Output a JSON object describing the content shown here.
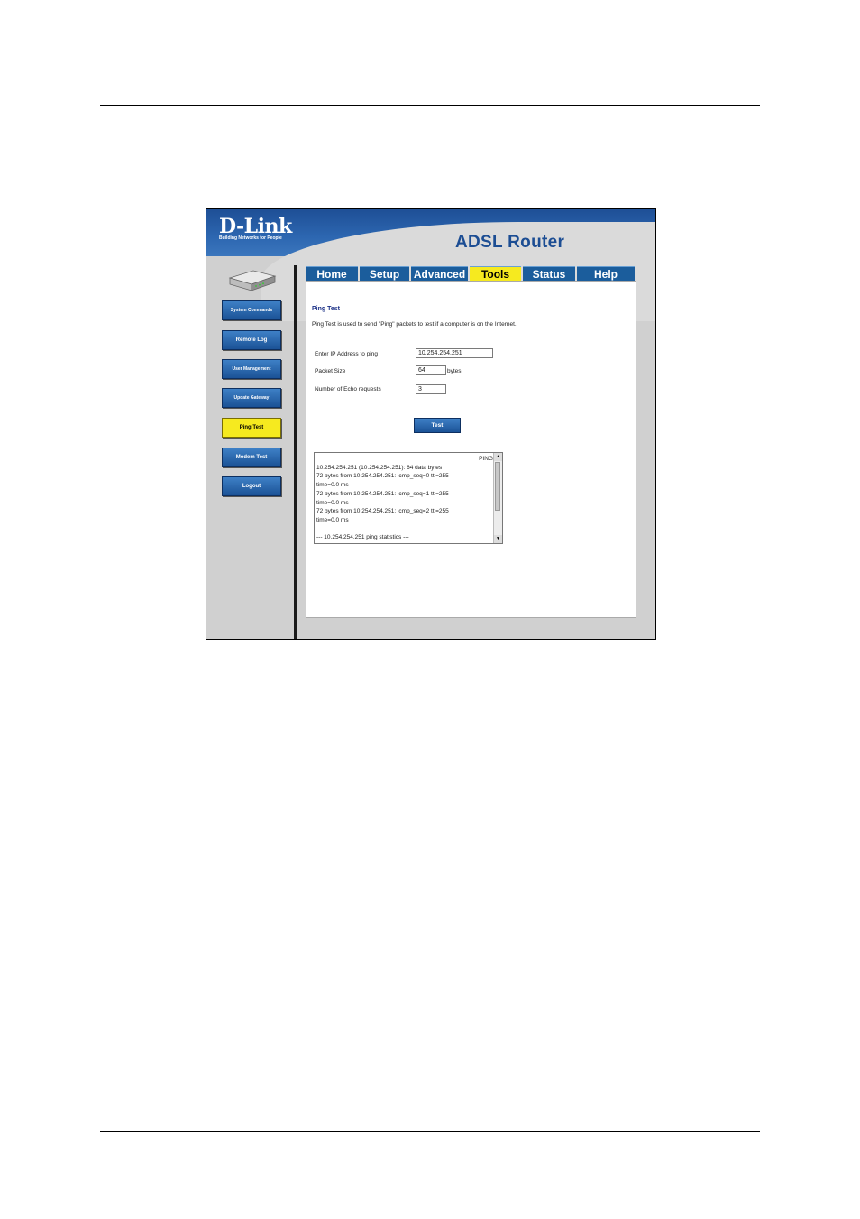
{
  "header": {
    "logo": "D-Link",
    "tagline": "Building Networks for People",
    "product": "ADSL Router"
  },
  "tabs": [
    {
      "label": "Home",
      "active": false
    },
    {
      "label": "Setup",
      "active": false
    },
    {
      "label": "Advanced",
      "active": false
    },
    {
      "label": "Tools",
      "active": true
    },
    {
      "label": "Status",
      "active": false
    },
    {
      "label": "Help",
      "active": false
    }
  ],
  "sidebar": {
    "items": [
      {
        "label": "System Commands"
      },
      {
        "label": "Remote Log"
      },
      {
        "label": "User Management"
      },
      {
        "label": "Update Gateway"
      },
      {
        "label": "Ping Test",
        "active": true
      },
      {
        "label": "Modem Test"
      },
      {
        "label": "Logout"
      }
    ]
  },
  "ping": {
    "title": "Ping Test",
    "description": "Ping Test is used to send \"Ping\" packets to test if a computer is on the Internet.",
    "ip_label": "Enter IP Address to ping",
    "ip_value": "10.254.254.251",
    "size_label": "Packet Size",
    "size_value": "64",
    "size_unit": "bytes",
    "echo_label": "Number of Echo requests",
    "echo_value": "3",
    "test_label": "Test",
    "output": [
      "PING",
      "10.254.254.251 (10.254.254.251): 64 data bytes",
      "72 bytes from 10.254.254.251: icmp_seq=0 ttl=255",
      "time=0.0 ms",
      "72 bytes from 10.254.254.251: icmp_seq=1 ttl=255",
      "time=0.0 ms",
      "72 bytes from 10.254.254.251: icmp_seq=2 ttl=255",
      "time=0.0 ms",
      "",
      "--- 10.254.254.251 ping statistics ---"
    ]
  },
  "colors": {
    "brand_blue": "#1b5d9c",
    "active_yellow": "#f6ea1f",
    "title_navy": "#1a2f86"
  }
}
